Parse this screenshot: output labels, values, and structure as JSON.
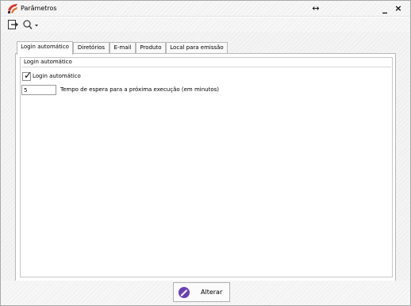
{
  "window": {
    "title": "Parâmetros",
    "resize_glyph": "↔",
    "minimize_glyph": "_",
    "close_glyph": "×"
  },
  "toolbar": {
    "icons": [
      "exit-icon",
      "search-icon",
      "dropdown-arrow-icon"
    ]
  },
  "tabs": [
    {
      "label": "Login automático",
      "active": true
    },
    {
      "label": "Diretórios",
      "active": false
    },
    {
      "label": "E-mail",
      "active": false
    },
    {
      "label": "Produto",
      "active": false
    },
    {
      "label": "Local para emissão",
      "active": false
    }
  ],
  "login_group": {
    "title": "Login automático",
    "checkbox_label": "Login automático",
    "checkbox_checked": true,
    "wait_value": "5",
    "wait_label": "Tempo de espera para a próxima execução (em minutos)"
  },
  "footer": {
    "alterar_label": "Alterar"
  },
  "colors": {
    "accent_purple": "#6a3fb5",
    "brand_red": "#d8322c"
  }
}
